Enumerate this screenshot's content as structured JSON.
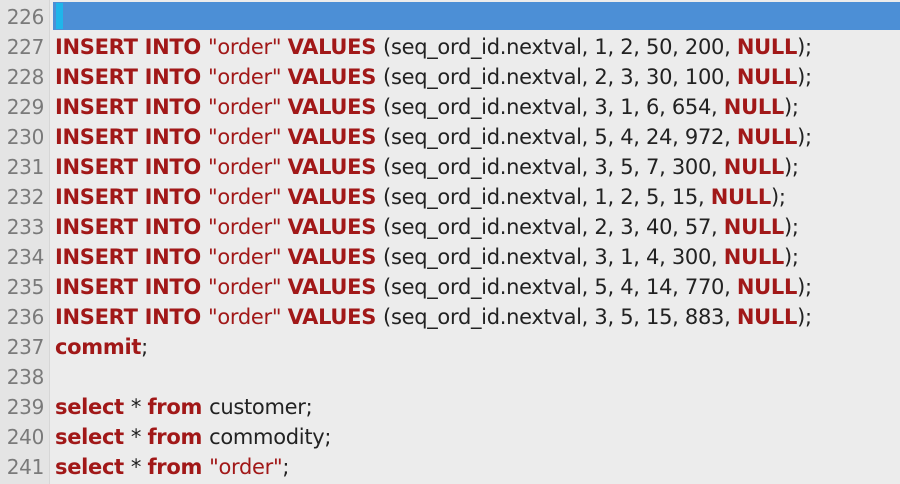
{
  "editor": {
    "lines": [
      {
        "num": "226",
        "parts": []
      },
      {
        "num": "227",
        "parts": [
          {
            "t": "INSERT INTO ",
            "c": "kw"
          },
          {
            "t": "\"order\" ",
            "c": "str"
          },
          {
            "t": "VALUES ",
            "c": "kw"
          },
          {
            "t": "(seq_ord_id.nextval, 1, 2, 50, 200, ",
            "c": "plain"
          },
          {
            "t": "NULL",
            "c": "kw"
          },
          {
            "t": ");",
            "c": "plain"
          }
        ]
      },
      {
        "num": "228",
        "parts": [
          {
            "t": "INSERT INTO ",
            "c": "kw"
          },
          {
            "t": "\"order\" ",
            "c": "str"
          },
          {
            "t": "VALUES ",
            "c": "kw"
          },
          {
            "t": "(seq_ord_id.nextval, 2, 3, 30, 100, ",
            "c": "plain"
          },
          {
            "t": "NULL",
            "c": "kw"
          },
          {
            "t": ");",
            "c": "plain"
          }
        ]
      },
      {
        "num": "229",
        "parts": [
          {
            "t": "INSERT INTO ",
            "c": "kw"
          },
          {
            "t": "\"order\" ",
            "c": "str"
          },
          {
            "t": "VALUES ",
            "c": "kw"
          },
          {
            "t": "(seq_ord_id.nextval, 3, 1, 6, 654, ",
            "c": "plain"
          },
          {
            "t": "NULL",
            "c": "kw"
          },
          {
            "t": ");",
            "c": "plain"
          }
        ]
      },
      {
        "num": "230",
        "parts": [
          {
            "t": "INSERT INTO ",
            "c": "kw"
          },
          {
            "t": "\"order\" ",
            "c": "str"
          },
          {
            "t": "VALUES ",
            "c": "kw"
          },
          {
            "t": "(seq_ord_id.nextval, 5, 4, 24, 972, ",
            "c": "plain"
          },
          {
            "t": "NULL",
            "c": "kw"
          },
          {
            "t": ");",
            "c": "plain"
          }
        ]
      },
      {
        "num": "231",
        "parts": [
          {
            "t": "INSERT INTO ",
            "c": "kw"
          },
          {
            "t": "\"order\" ",
            "c": "str"
          },
          {
            "t": "VALUES ",
            "c": "kw"
          },
          {
            "t": "(seq_ord_id.nextval, 3, 5, 7, 300, ",
            "c": "plain"
          },
          {
            "t": "NULL",
            "c": "kw"
          },
          {
            "t": ");",
            "c": "plain"
          }
        ]
      },
      {
        "num": "232",
        "parts": [
          {
            "t": "INSERT INTO ",
            "c": "kw"
          },
          {
            "t": "\"order\" ",
            "c": "str"
          },
          {
            "t": "VALUES ",
            "c": "kw"
          },
          {
            "t": "(seq_ord_id.nextval, 1, 2, 5, 15, ",
            "c": "plain"
          },
          {
            "t": "NULL",
            "c": "kw"
          },
          {
            "t": ");",
            "c": "plain"
          }
        ]
      },
      {
        "num": "233",
        "parts": [
          {
            "t": "INSERT INTO ",
            "c": "kw"
          },
          {
            "t": "\"order\" ",
            "c": "str"
          },
          {
            "t": "VALUES ",
            "c": "kw"
          },
          {
            "t": "(seq_ord_id.nextval, 2, 3, 40, 57, ",
            "c": "plain"
          },
          {
            "t": "NULL",
            "c": "kw"
          },
          {
            "t": ");",
            "c": "plain"
          }
        ]
      },
      {
        "num": "234",
        "parts": [
          {
            "t": "INSERT INTO ",
            "c": "kw"
          },
          {
            "t": "\"order\" ",
            "c": "str"
          },
          {
            "t": "VALUES ",
            "c": "kw"
          },
          {
            "t": "(seq_ord_id.nextval, 3, 1, 4, 300, ",
            "c": "plain"
          },
          {
            "t": "NULL",
            "c": "kw"
          },
          {
            "t": ");",
            "c": "plain"
          }
        ]
      },
      {
        "num": "235",
        "parts": [
          {
            "t": "INSERT INTO ",
            "c": "kw"
          },
          {
            "t": "\"order\" ",
            "c": "str"
          },
          {
            "t": "VALUES ",
            "c": "kw"
          },
          {
            "t": "(seq_ord_id.nextval, 5, 4, 14, 770, ",
            "c": "plain"
          },
          {
            "t": "NULL",
            "c": "kw"
          },
          {
            "t": ");",
            "c": "plain"
          }
        ]
      },
      {
        "num": "236",
        "parts": [
          {
            "t": "INSERT INTO ",
            "c": "kw"
          },
          {
            "t": "\"order\" ",
            "c": "str"
          },
          {
            "t": "VALUES ",
            "c": "kw"
          },
          {
            "t": "(seq_ord_id.nextval, 3, 5, 15, 883, ",
            "c": "plain"
          },
          {
            "t": "NULL",
            "c": "kw"
          },
          {
            "t": ");",
            "c": "plain"
          }
        ]
      },
      {
        "num": "237",
        "parts": [
          {
            "t": "commit",
            "c": "kw"
          },
          {
            "t": ";",
            "c": "plain"
          }
        ]
      },
      {
        "num": "238",
        "parts": []
      },
      {
        "num": "239",
        "parts": [
          {
            "t": "select ",
            "c": "kw"
          },
          {
            "t": "* ",
            "c": "plain"
          },
          {
            "t": "from ",
            "c": "kw"
          },
          {
            "t": "customer;",
            "c": "plain"
          }
        ]
      },
      {
        "num": "240",
        "parts": [
          {
            "t": "select ",
            "c": "kw"
          },
          {
            "t": "* ",
            "c": "plain"
          },
          {
            "t": "from ",
            "c": "kw"
          },
          {
            "t": "commodity;",
            "c": "plain"
          }
        ]
      },
      {
        "num": "241",
        "parts": [
          {
            "t": "select ",
            "c": "kw"
          },
          {
            "t": "* ",
            "c": "plain"
          },
          {
            "t": "from ",
            "c": "kw"
          },
          {
            "t": "\"order\"",
            "c": "str"
          },
          {
            "t": ";",
            "c": "plain"
          }
        ]
      }
    ]
  },
  "colors": {
    "keyword": "#a11818",
    "plain_text": "#222222",
    "line_number": "#7a7a7a",
    "current_line_highlight": "#4c8fd6",
    "caret_marker": "#1fb5ea",
    "background": "#ececec"
  }
}
